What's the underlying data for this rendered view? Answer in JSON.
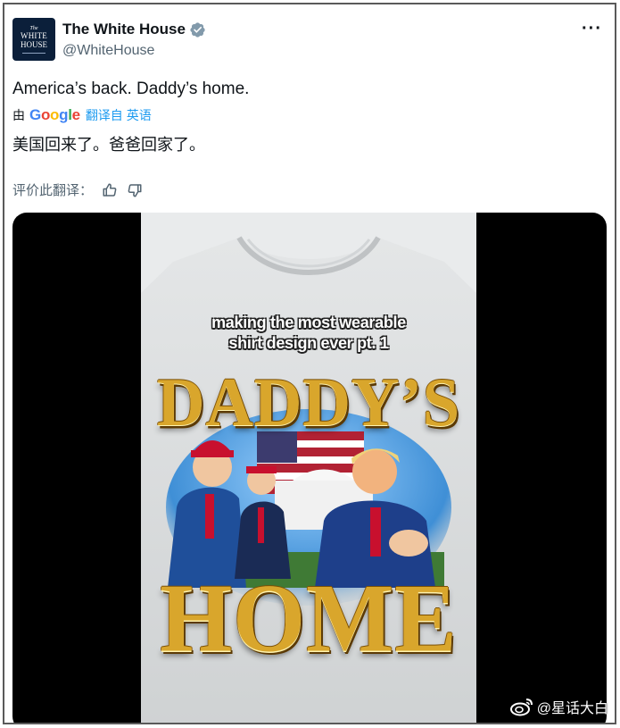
{
  "account": {
    "display_name": "The White House",
    "handle": "@WhiteHouse",
    "avatar_lines": [
      "The",
      "WHITE",
      "HOUSE"
    ],
    "verified_color": "#829aab"
  },
  "more_label": "···",
  "tweet": {
    "text": "America’s back. Daddy’s home."
  },
  "translation": {
    "by_label": "由",
    "provider": "Google",
    "from_label": "翻译自 英语",
    "text": "美国回来了。爸爸回家了。",
    "rate_label": "评价此翻译："
  },
  "media": {
    "caption_line1": "making the most wearable",
    "caption_line2": "shirt design ever pt. 1",
    "headline_top": "DADDY’S",
    "headline_bottom": "HOME",
    "shirt_color": "#dcdedf",
    "gold_color": "#d9a62c"
  },
  "watermark": {
    "text": "@星话大白"
  }
}
